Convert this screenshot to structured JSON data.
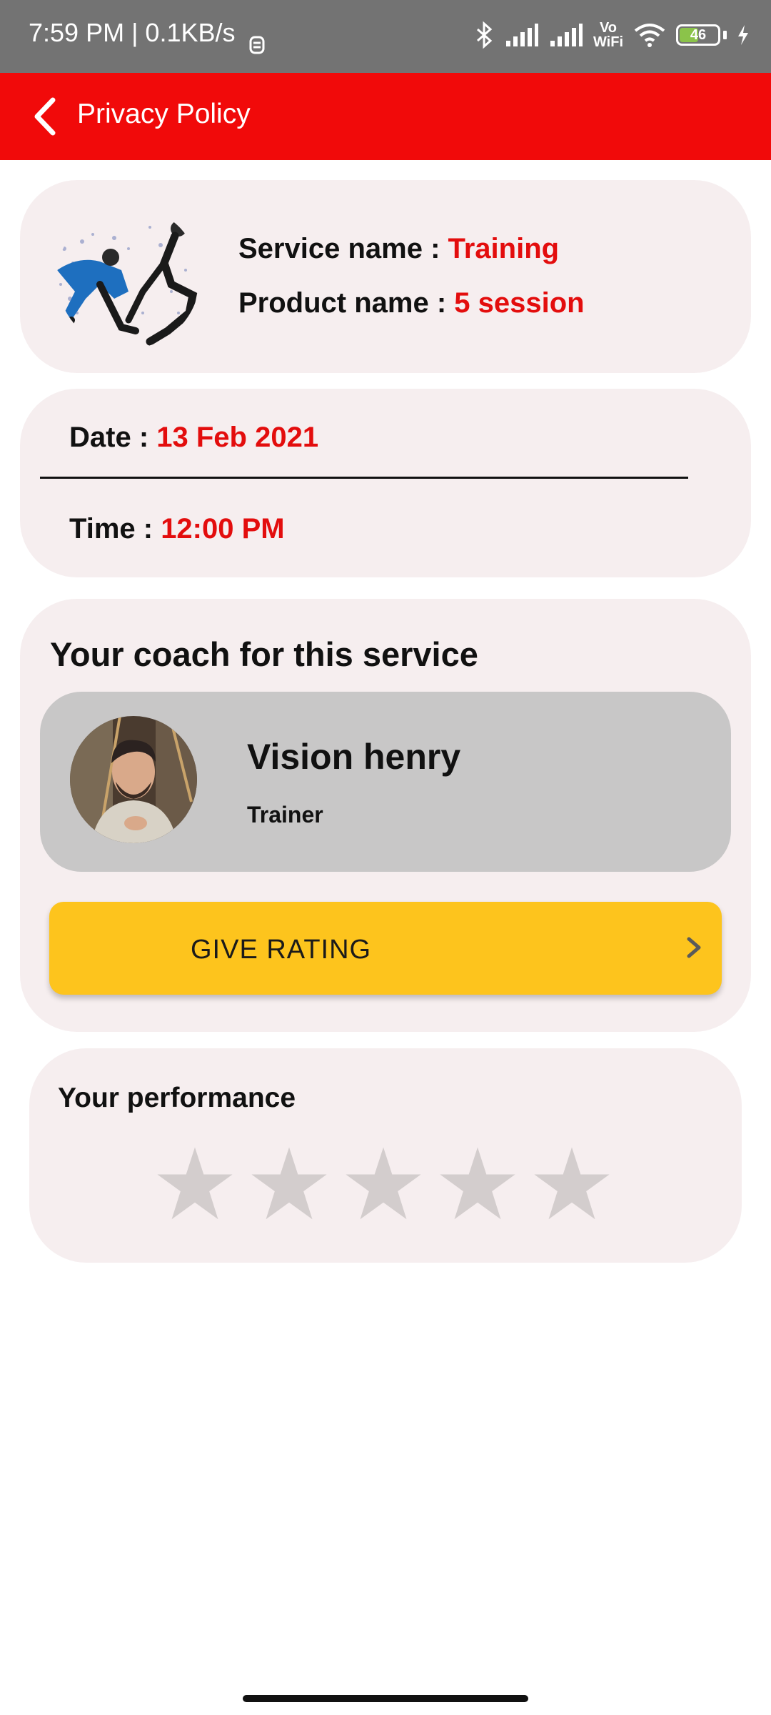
{
  "status_bar": {
    "time": "7:59 PM | 0.1KB/s",
    "voice_top": "Vo",
    "voice_bottom": "WiFi",
    "battery": "46"
  },
  "app_bar": {
    "title": "Privacy Policy"
  },
  "service": {
    "service_label": "Service name : ",
    "service_value": "Training",
    "product_label": "Product name : ",
    "product_value": "5 session"
  },
  "schedule": {
    "date_label": "Date : ",
    "date_value": "13 Feb 2021",
    "time_label": "Time : ",
    "time_value": "12:00 PM"
  },
  "coach": {
    "section_title": "Your coach for this service",
    "name": "Vision henry",
    "role": "Trainer",
    "rating_button": "GIVE RATING"
  },
  "performance": {
    "title": "Your performance",
    "stars_total": 5,
    "stars_filled": 0,
    "star_color": "#d3cdcd"
  },
  "colors": {
    "accent": "#f10a0a",
    "value_red": "#e30d0d",
    "button_yellow": "#fdc41d",
    "card_bg": "#f6eeef"
  }
}
